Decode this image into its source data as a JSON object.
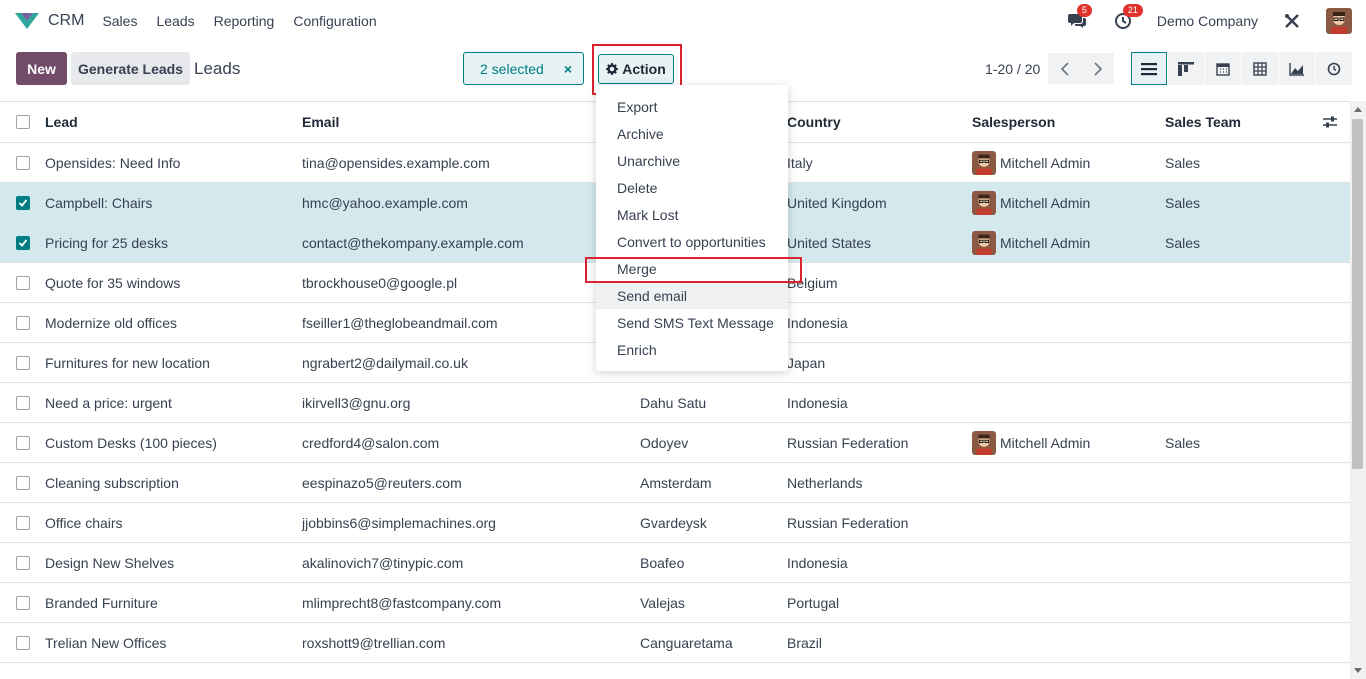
{
  "app": {
    "brand": "CRM",
    "nav": [
      "Sales",
      "Leads",
      "Reporting",
      "Configuration"
    ],
    "messages_count": "5",
    "activities_count": "21",
    "company": "Demo Company"
  },
  "control_panel": {
    "new_label": "New",
    "generate_label": "Generate Leads",
    "title": "Leads",
    "selected_label": "2 selected",
    "clear_selection": "×",
    "action_label": "Action",
    "pager": "1-20 / 20"
  },
  "columns": {
    "lead": "Lead",
    "email": "Email",
    "country": "Country",
    "salesperson": "Salesperson",
    "team": "Sales Team"
  },
  "rows": [
    {
      "lead": "Opensides: Need Info",
      "email": "tina@opensides.example.com",
      "city": "",
      "country": "Italy",
      "salesperson": "Mitchell Admin",
      "team": "Sales",
      "selected": false
    },
    {
      "lead": "Campbell: Chairs",
      "email": "hmc@yahoo.example.com",
      "city": "",
      "country": "United Kingdom",
      "salesperson": "Mitchell Admin",
      "team": "Sales",
      "selected": true
    },
    {
      "lead": "Pricing for 25 desks",
      "email": "contact@thekompany.example.com",
      "city": "",
      "country": "United States",
      "salesperson": "Mitchell Admin",
      "team": "Sales",
      "selected": true
    },
    {
      "lead": "Quote for 35 windows",
      "email": "tbrockhouse0@google.pl",
      "city": "",
      "country": "Belgium",
      "salesperson": "",
      "team": "",
      "selected": false
    },
    {
      "lead": "Modernize old offices",
      "email": "fseiller1@theglobeandmail.com",
      "city": "",
      "country": "Indonesia",
      "salesperson": "",
      "team": "",
      "selected": false
    },
    {
      "lead": "Furnitures for new location",
      "email": "ngrabert2@dailymail.co.uk",
      "city": "",
      "country": "Japan",
      "salesperson": "",
      "team": "",
      "selected": false
    },
    {
      "lead": "Need a price: urgent",
      "email": "ikirvell3@gnu.org",
      "city": "Dahu Satu",
      "country": "Indonesia",
      "salesperson": "",
      "team": "",
      "selected": false
    },
    {
      "lead": "Custom Desks (100 pieces)",
      "email": "credford4@salon.com",
      "city": "Odoyev",
      "country": "Russian Federation",
      "salesperson": "Mitchell Admin",
      "team": "Sales",
      "selected": false
    },
    {
      "lead": "Cleaning subscription",
      "email": "eespinazo5@reuters.com",
      "city": "Amsterdam",
      "country": "Netherlands",
      "salesperson": "",
      "team": "",
      "selected": false
    },
    {
      "lead": "Office chairs",
      "email": "jjobbins6@simplemachines.org",
      "city": "Gvardeysk",
      "country": "Russian Federation",
      "salesperson": "",
      "team": "",
      "selected": false
    },
    {
      "lead": "Design New Shelves",
      "email": "akalinovich7@tinypic.com",
      "city": "Boafeo",
      "country": "Indonesia",
      "salesperson": "",
      "team": "",
      "selected": false
    },
    {
      "lead": "Branded Furniture",
      "email": "mlimprecht8@fastcompany.com",
      "city": "Valejas",
      "country": "Portugal",
      "salesperson": "",
      "team": "",
      "selected": false
    },
    {
      "lead": "Trelian New Offices",
      "email": "roxshott9@trellian.com",
      "city": "Canguaretama",
      "country": "Brazil",
      "salesperson": "",
      "team": "",
      "selected": false
    }
  ],
  "action_menu": [
    "Export",
    "Archive",
    "Unarchive",
    "Delete",
    "Mark Lost",
    "Convert to opportunities",
    "Merge",
    "Send email",
    "Send SMS Text Message",
    "Enrich"
  ],
  "colors": {
    "primary": "#714b67",
    "accent": "#017e84",
    "selected_row": "#d3e9ed",
    "highlight": "#d9232e"
  }
}
